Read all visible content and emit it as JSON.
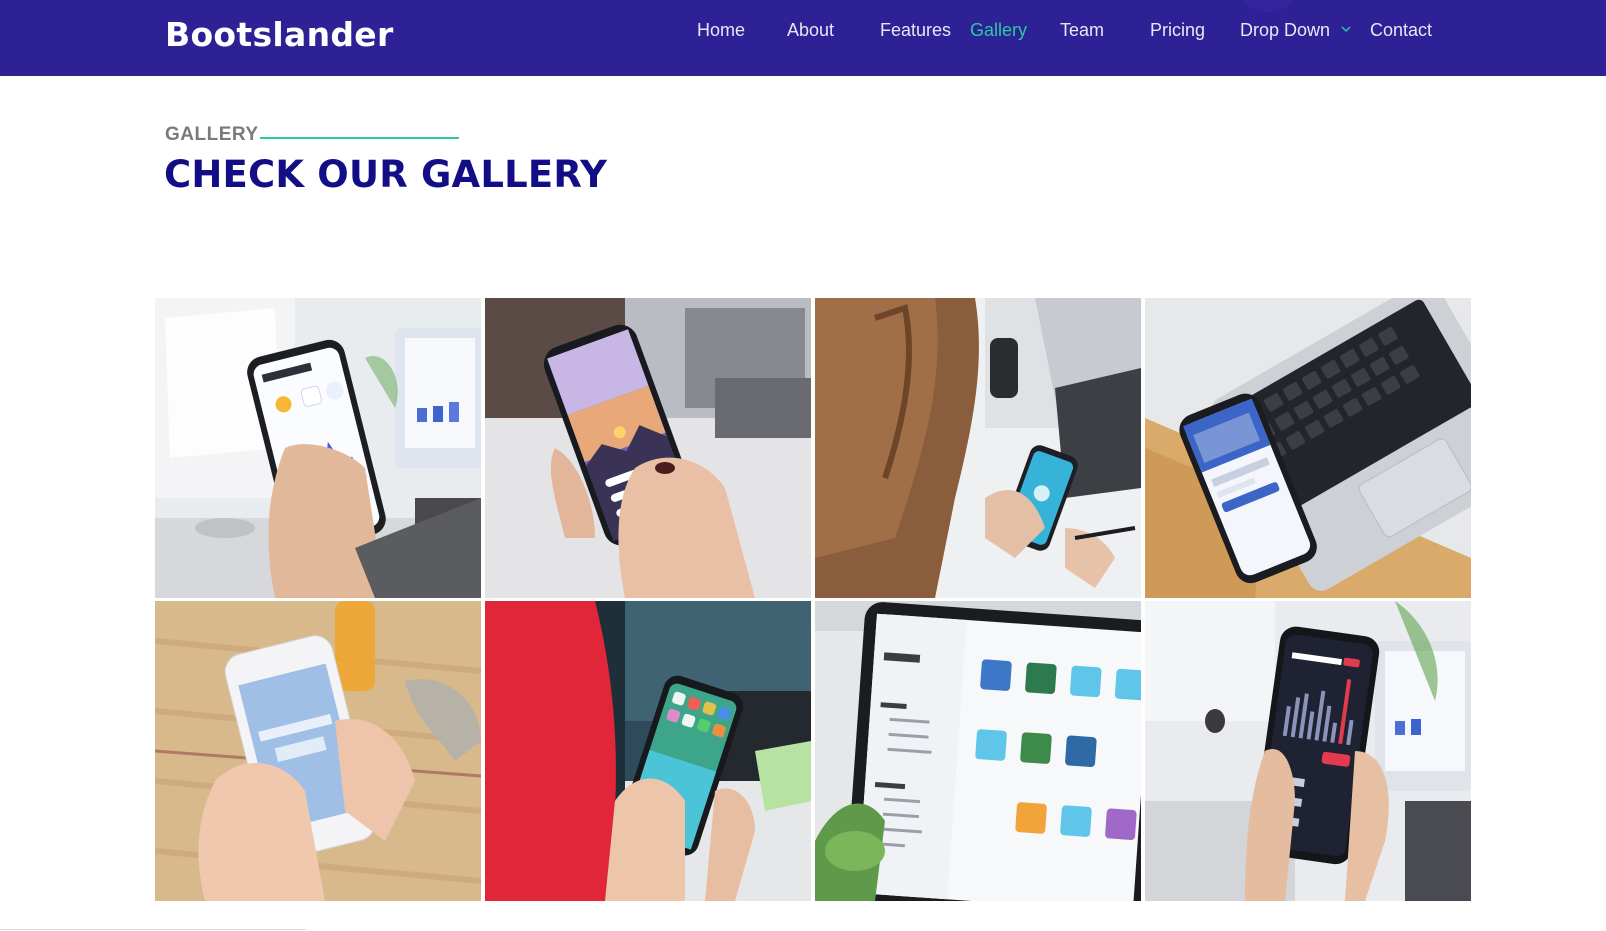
{
  "header": {
    "logo": "Bootslander",
    "nav": [
      {
        "label": "Home",
        "active": false
      },
      {
        "label": "About",
        "active": false
      },
      {
        "label": "Features",
        "active": false
      },
      {
        "label": "Gallery",
        "active": true
      },
      {
        "label": "Team",
        "active": false
      },
      {
        "label": "Pricing",
        "active": false
      },
      {
        "label": "Drop Down",
        "active": false,
        "has_dropdown": true
      },
      {
        "label": "Contact",
        "active": false
      }
    ]
  },
  "section": {
    "label": "GALLERY",
    "heading": "CHECK OUR GALLERY"
  },
  "gallery": {
    "items": [
      {
        "name": "gallery-item-1",
        "subject": "hand holding phone with weather app in front of desktop"
      },
      {
        "name": "gallery-item-2",
        "subject": "hands holding phone with sunset app near laptop"
      },
      {
        "name": "gallery-item-3",
        "subject": "woman using phone at desk with laptop"
      },
      {
        "name": "gallery-item-4",
        "subject": "phone with social app next to laptop keyboard"
      },
      {
        "name": "gallery-item-5",
        "subject": "hand holding white phone over wooden table"
      },
      {
        "name": "gallery-item-6",
        "subject": "hands holding phone with home screen in front of monitors"
      },
      {
        "name": "gallery-item-7",
        "subject": "tablet showing Finder files app"
      },
      {
        "name": "gallery-item-8",
        "subject": "hand holding phone with Earthquake app in front of desktop"
      }
    ]
  },
  "colors": {
    "header_bg": "#2e2195",
    "accent": "#2bc9a4",
    "heading": "#140e86",
    "label": "#7a7a7a"
  }
}
